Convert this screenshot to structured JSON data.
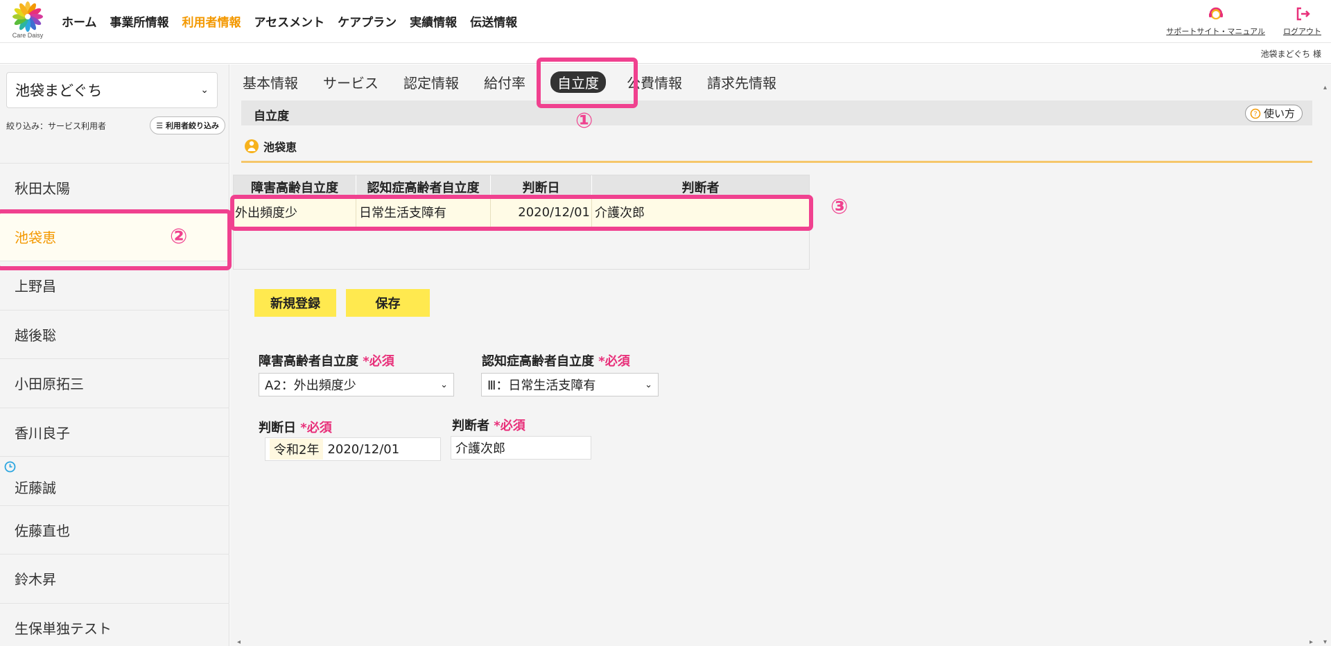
{
  "app": {
    "logo_text": "Care Daisy",
    "nav": [
      "ホーム",
      "事業所情報",
      "利用者情報",
      "アセスメント",
      "ケアプラン",
      "実績情報",
      "伝送情報"
    ],
    "active_nav": "利用者情報",
    "support_link": "サポートサイト・マニュアル",
    "logout": "ログアウト",
    "user_name": "池袋まどぐち 様",
    "accent_color": "#f39800",
    "highlight_color": "#f0418f"
  },
  "sidebar": {
    "office": "池袋まどぐち",
    "filter_label": "絞り込み：サービス利用者",
    "filter_button": "利用者絞り込み",
    "clients": [
      "秋田太陽",
      "池袋恵",
      "上野昌",
      "越後聡",
      "小田原拓三",
      "香川良子",
      "近藤誠",
      "佐藤直也",
      "鈴木昇",
      "生保単独テスト"
    ],
    "selected_client": "池袋恵"
  },
  "main": {
    "tabs": [
      "基本情報",
      "サービス",
      "認定情報",
      "給付率",
      "自立度",
      "公費情報",
      "請求先情報"
    ],
    "active_tab": "自立度",
    "section_title": "自立度",
    "howto_button": "使い方",
    "person_name": "池袋恵",
    "table": {
      "headers": [
        "障害高齢自立度",
        "認知症高齢者自立度",
        "判断日",
        "判断者"
      ],
      "rows": [
        [
          "外出頻度少",
          "日常生活支障有",
          "2020/12/01",
          "介護次郎"
        ]
      ]
    },
    "buttons": {
      "new": "新規登録",
      "save": "保存"
    },
    "form": {
      "disability_label": "障害高齢者自立度",
      "dementia_label": "認知症高齢者自立度",
      "required": "*必須",
      "disability_value": "A2：外出頻度少",
      "dementia_value": "Ⅲ：日常生活支障有",
      "date_label": "判断日",
      "date_era": "令和2年",
      "date_value": "2020/12/01",
      "judge_label": "判断者",
      "judge_value": "介護次郎"
    },
    "annotations": [
      "①",
      "②",
      "③"
    ]
  }
}
